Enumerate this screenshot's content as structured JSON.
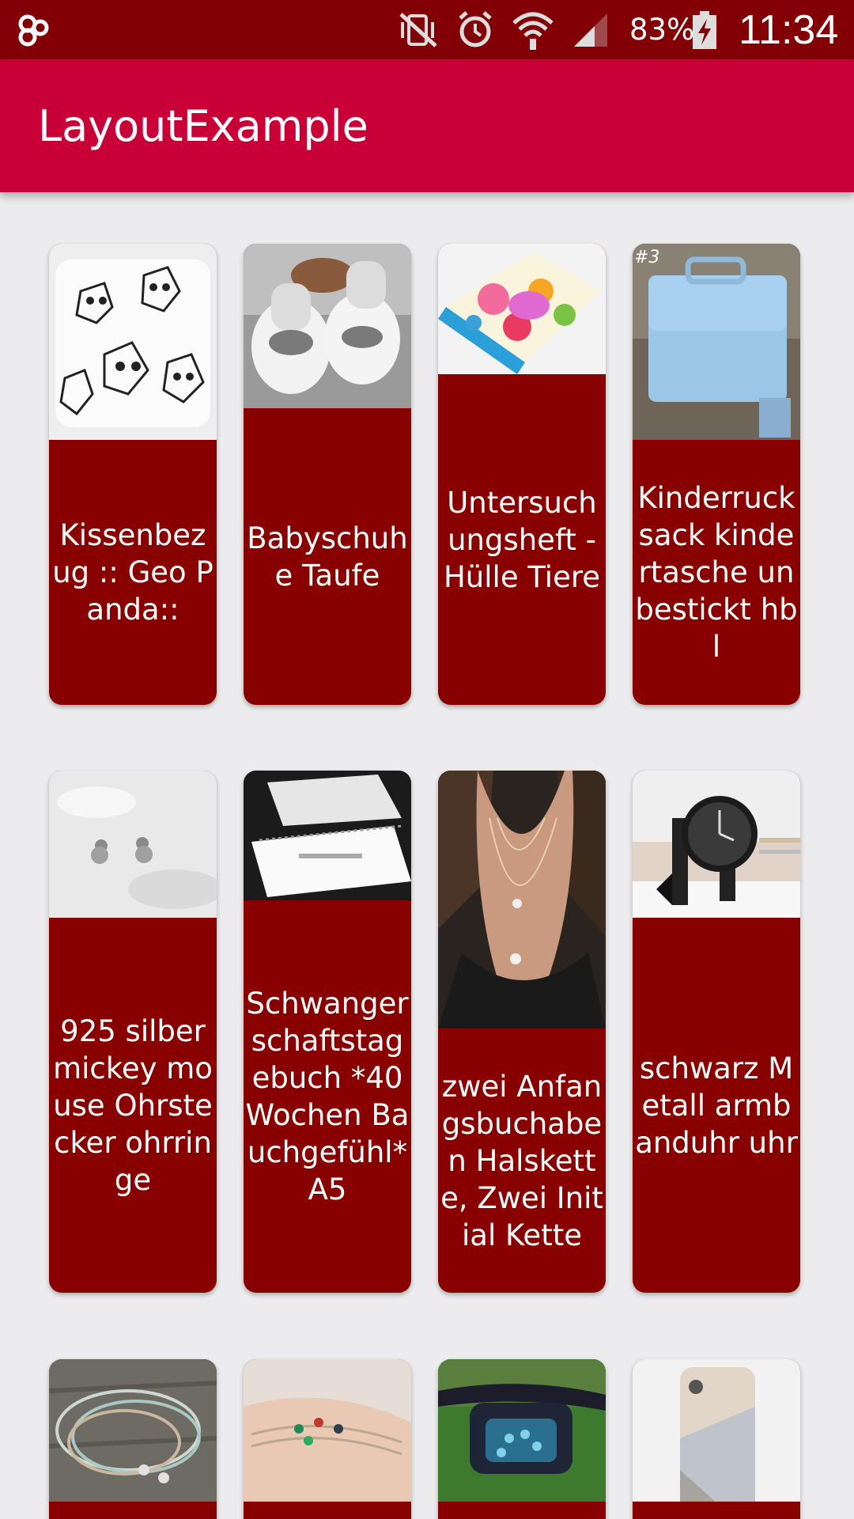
{
  "status_bar": {
    "app_icon": "notification-app-icon",
    "mute_icon": "vibrate-off-icon",
    "alarm_icon": "alarm-clock-icon",
    "wifi_icon": "wifi-icon",
    "signal_icon": "cell-signal-icon",
    "battery_percent": "83%",
    "battery_icon": "battery-charging-icon",
    "time": "11:34"
  },
  "app_bar": {
    "title": "LayoutExample",
    "color": "#c90037"
  },
  "colors": {
    "status_bar": "#820005",
    "card": "#880000",
    "background": "#ececee"
  },
  "cards": [
    {
      "title": "Kissenbezug :: Geo Panda::",
      "image": "geometric panda pillow"
    },
    {
      "title": "Babyschuhe Taufe",
      "image": "white crochet baby shoes"
    },
    {
      "title": "Untersuchungsheft - Hülle Tiere",
      "image": "colorful animal print sleeve"
    },
    {
      "title": "Kinderrucksack kindertasche unbestickt hbl",
      "image": "light blue kids backpack",
      "image_overlay_text": "#3"
    },
    {
      "title": "925 silber mickey mouse Ohrstecker ohrringe",
      "image": "silver stud earrings on fur"
    },
    {
      "title": "Schwangerschaftstagebuch *40 Wochen Bauchgefühl*A5",
      "image": "white spiral notebook"
    },
    {
      "title": "zwei Anfangsbuchaben Halskette, Zwei Initial Kette",
      "image": "layered necklace"
    },
    {
      "title": "schwarz Metall armbanduhr uhr",
      "image": "black wrist watch with bracelets"
    },
    {
      "title": "",
      "image": "leather string bracelets"
    },
    {
      "title": "",
      "image": "beaded bracelets on wrist"
    },
    {
      "title": "",
      "image": "blue patterned hip bag"
    },
    {
      "title": "",
      "image": "wood pattern phone case"
    }
  ]
}
